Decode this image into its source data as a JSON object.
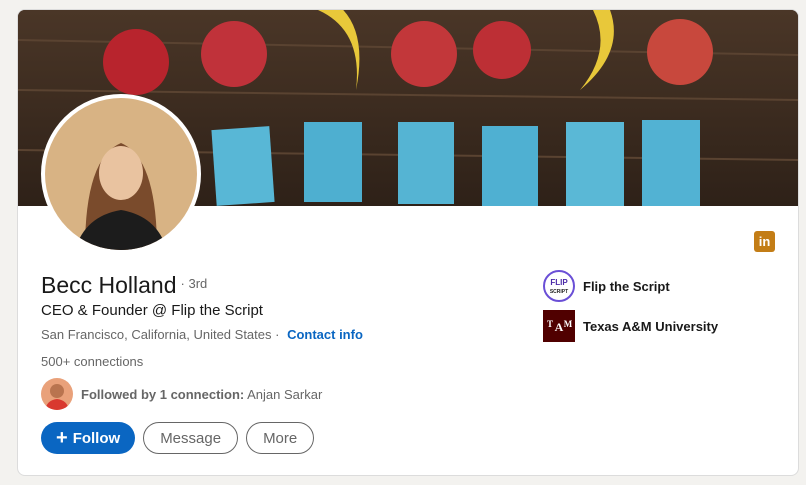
{
  "profile": {
    "name": "Becc Holland",
    "degree": "· 3rd",
    "headline": "CEO & Founder @ Flip the Script",
    "location": "San Francisco, California, United States ·",
    "contact_link": "Contact info",
    "connections": "500+ connections",
    "followed_prefix": "Followed by 1 connection:",
    "followed_name": "Anjan Sarkar"
  },
  "actions": {
    "follow_label": "Follow",
    "message_label": "Message",
    "more_label": "More"
  },
  "side": {
    "company": "Flip the Script",
    "school": "Texas A&M University",
    "company_logo_text": "FLIP SCRIPT",
    "school_logo_text": "ATM"
  },
  "icons": {
    "linkedin": "linkedin-icon",
    "plus": "plus-icon"
  },
  "colors": {
    "accent": "#0a66c2",
    "linkedin_badge": "#c37d16",
    "texas_am_maroon": "#500000"
  }
}
